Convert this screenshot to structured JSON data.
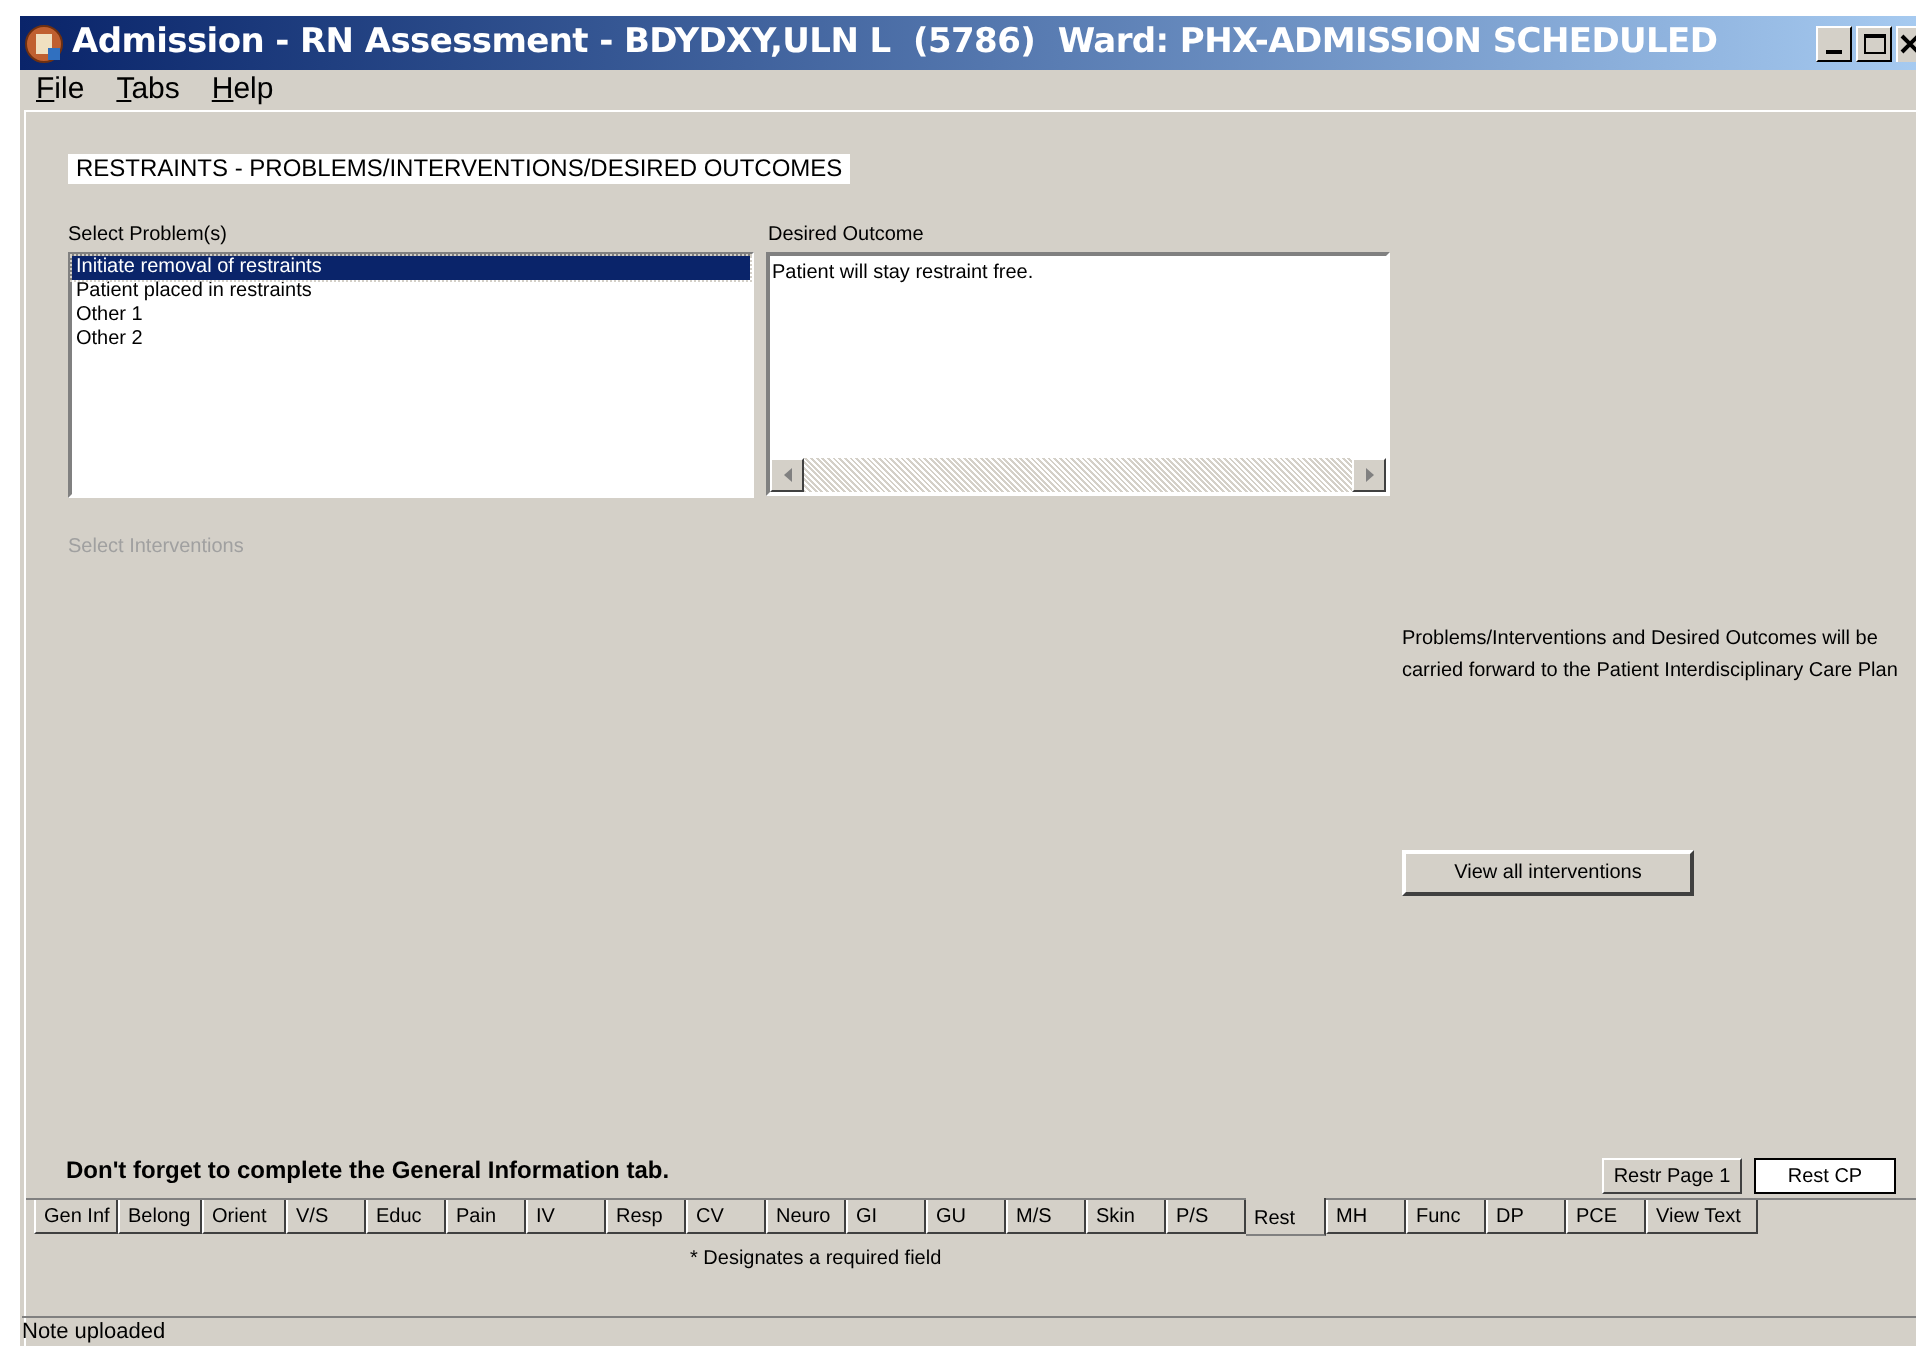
{
  "window": {
    "title": "Admission - RN Assessment - BDYDXY,ULN L  (5786)  Ward: PHX-ADMISSION SCHEDULED"
  },
  "menu": [
    "File",
    "Tabs",
    "Help"
  ],
  "section_heading": "RESTRAINTS - PROBLEMS/INTERVENTIONS/DESIRED OUTCOMES",
  "problems": {
    "label": "Select Problem(s)",
    "items": [
      {
        "text": "Initiate removal of restraints",
        "selected": true
      },
      {
        "text": "Patient placed in restraints",
        "selected": false
      },
      {
        "text": "Other 1",
        "selected": false
      },
      {
        "text": "Other 2",
        "selected": false
      }
    ]
  },
  "desired_outcome": {
    "label": "Desired Outcome",
    "value": "Patient will stay restraint free."
  },
  "interventions": {
    "label": "Select Interventions",
    "disabled": true
  },
  "care_plan_note": "Problems/Interventions and Desired Outcomes will be carried forward to the Patient Interdisciplinary Care Plan",
  "view_all_button": "View all interventions",
  "reminder": "Don't forget to complete the General Information tab.",
  "page_buttons": [
    {
      "label": "Restr Page 1",
      "selected": false
    },
    {
      "label": "Rest CP",
      "selected": true
    }
  ],
  "tabs": [
    {
      "label": "Gen Inf",
      "selected": false
    },
    {
      "label": "Belong",
      "selected": false
    },
    {
      "label": "Orient",
      "selected": false
    },
    {
      "label": "V/S",
      "selected": false
    },
    {
      "label": "Educ",
      "selected": false
    },
    {
      "label": "Pain",
      "selected": false
    },
    {
      "label": "IV",
      "selected": false
    },
    {
      "label": "Resp",
      "selected": false
    },
    {
      "label": "CV",
      "selected": false
    },
    {
      "label": "Neuro",
      "selected": false
    },
    {
      "label": "GI",
      "selected": false
    },
    {
      "label": "GU",
      "selected": false
    },
    {
      "label": "M/S",
      "selected": false
    },
    {
      "label": "Skin",
      "selected": false
    },
    {
      "label": "P/S",
      "selected": false
    },
    {
      "label": "Rest",
      "selected": true
    },
    {
      "label": "MH",
      "selected": false
    },
    {
      "label": "Func",
      "selected": false
    },
    {
      "label": "DP",
      "selected": false
    },
    {
      "label": "PCE",
      "selected": false
    },
    {
      "label": "View Text",
      "selected": false
    }
  ],
  "required_note": "* Designates a required field",
  "status_bar": "Note uploaded"
}
